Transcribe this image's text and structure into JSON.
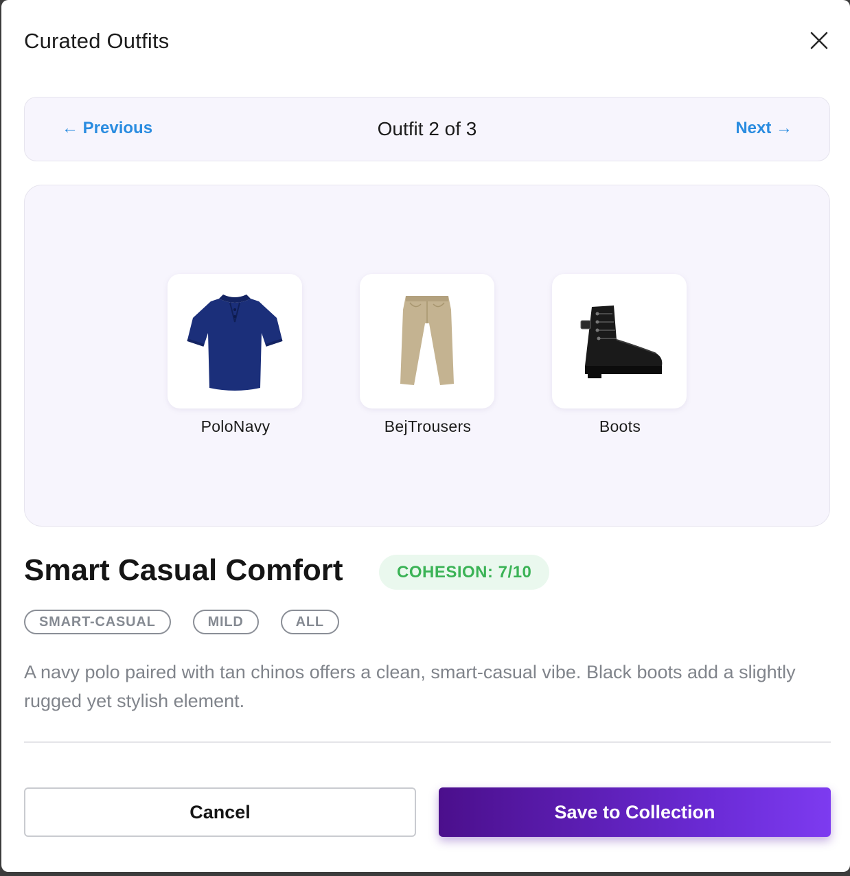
{
  "modal": {
    "title": "Curated Outfits",
    "close_icon": "close-icon"
  },
  "navigation": {
    "previous_label": "← Previous",
    "counter_label": "Outfit 2 of 3",
    "next_label": "Next →",
    "current": 2,
    "total": 3
  },
  "outfit": {
    "items": [
      {
        "label": "PoloNavy",
        "icon": "polo-shirt-icon",
        "color": "#1b2f7a"
      },
      {
        "label": "BejTrousers",
        "icon": "trousers-icon",
        "color": "#c4b391"
      },
      {
        "label": "Boots",
        "icon": "boot-icon",
        "color": "#1a1a1a"
      }
    ],
    "name": "Smart Casual Comfort",
    "cohesion_label": "COHESION: 7/10",
    "tags": [
      "SMART-CASUAL",
      "MILD",
      "ALL"
    ],
    "description": "A navy polo paired with tan chinos offers a clean, smart-casual vibe. Black boots add a slightly rugged yet stylish element."
  },
  "actions": {
    "cancel_label": "Cancel",
    "save_label": "Save to Collection"
  },
  "colors": {
    "link": "#2a8ce0",
    "cohesion_text": "#3bb356",
    "cohesion_bg": "#eaf8ee",
    "primary_start": "#4b0f8c",
    "primary_end": "#7d3bf0",
    "panel_bg": "#f7f5fd"
  }
}
